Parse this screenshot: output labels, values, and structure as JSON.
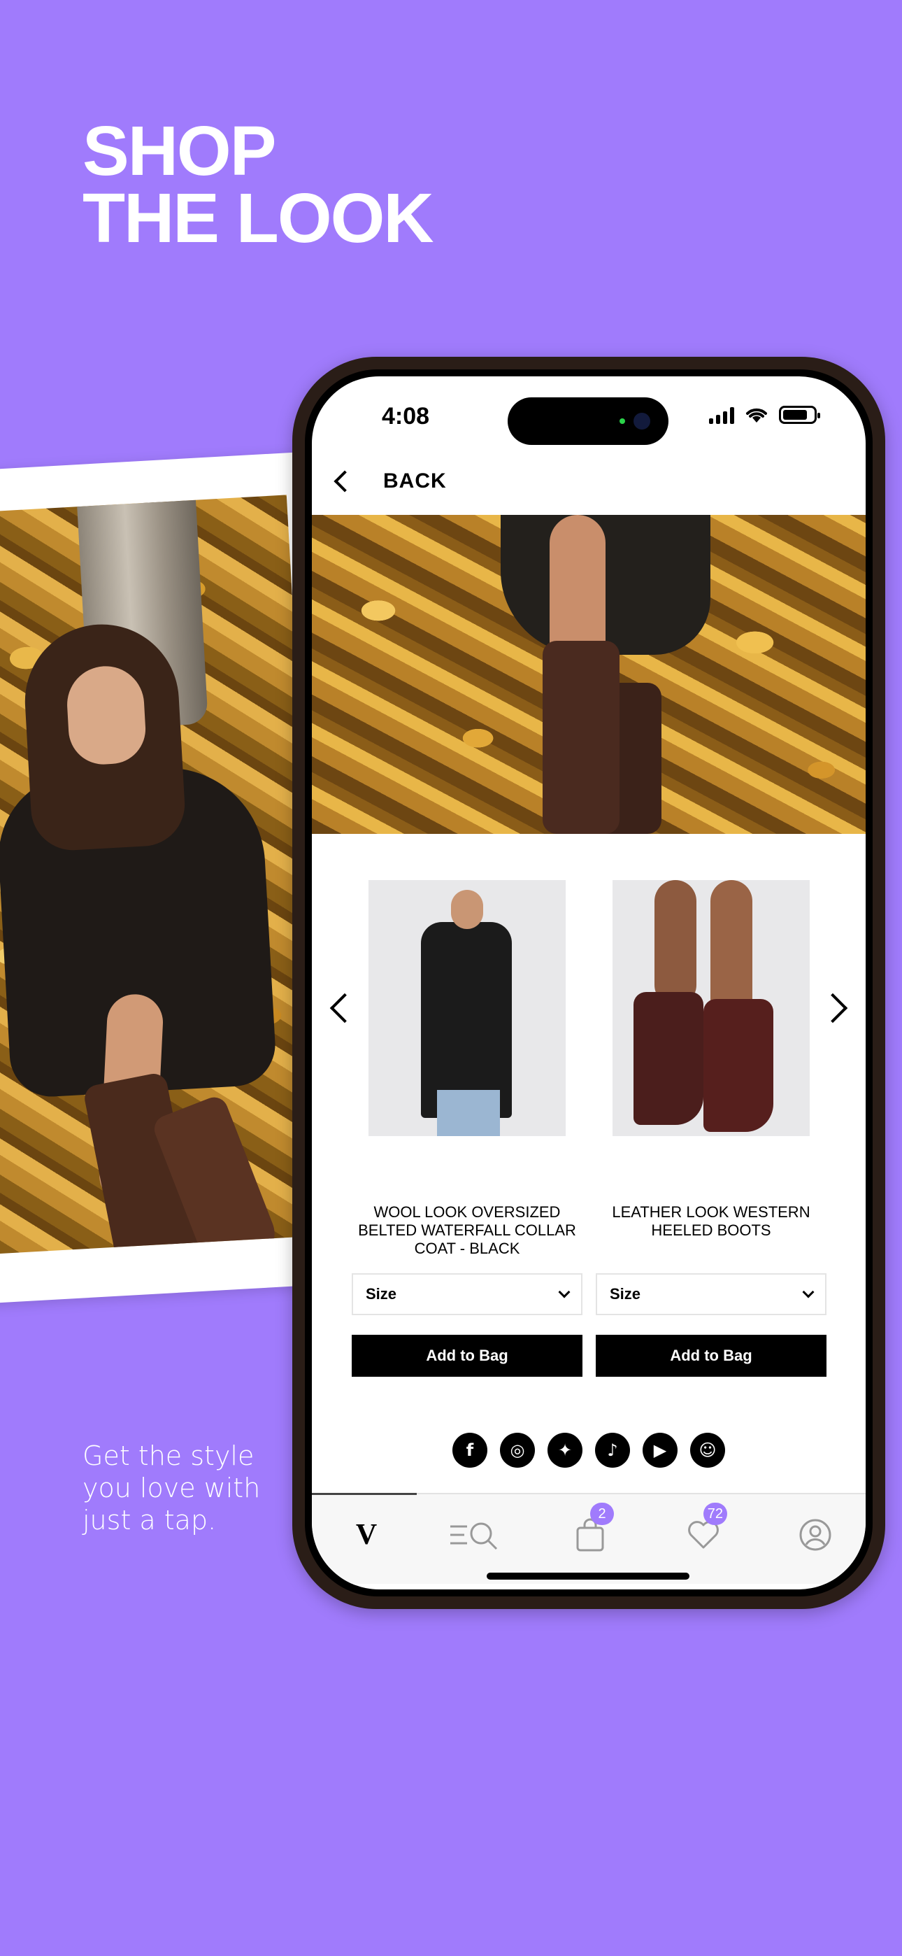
{
  "promo": {
    "headline_line1": "SHOP",
    "headline_line2": "THE LOOK",
    "tagline": "Get the style you love with just a tap.",
    "background_color": "#a07bfc"
  },
  "status_bar": {
    "time": "4:08"
  },
  "nav": {
    "back_label": "BACK"
  },
  "products": [
    {
      "name": "WOOL LOOK OVERSIZED BELTED WATERFALL COLLAR COAT - BLACK",
      "size_label": "Size",
      "add_label": "Add to Bag"
    },
    {
      "name": "LEATHER LOOK WESTERN HEELED BOOTS",
      "size_label": "Size",
      "add_label": "Add to Bag"
    }
  ],
  "socials": [
    {
      "icon": "facebook-icon",
      "glyph": "f"
    },
    {
      "icon": "instagram-icon",
      "glyph": "◎"
    },
    {
      "icon": "twitter-icon",
      "glyph": "✦"
    },
    {
      "icon": "tiktok-icon",
      "glyph": "♪"
    },
    {
      "icon": "youtube-icon",
      "glyph": "▶"
    },
    {
      "icon": "snapchat-icon",
      "glyph": "☺"
    }
  ],
  "tabbar": {
    "home_logo": "V",
    "bag_count": "2",
    "wishlist_count": "72",
    "accent_color": "#a07bfc"
  }
}
